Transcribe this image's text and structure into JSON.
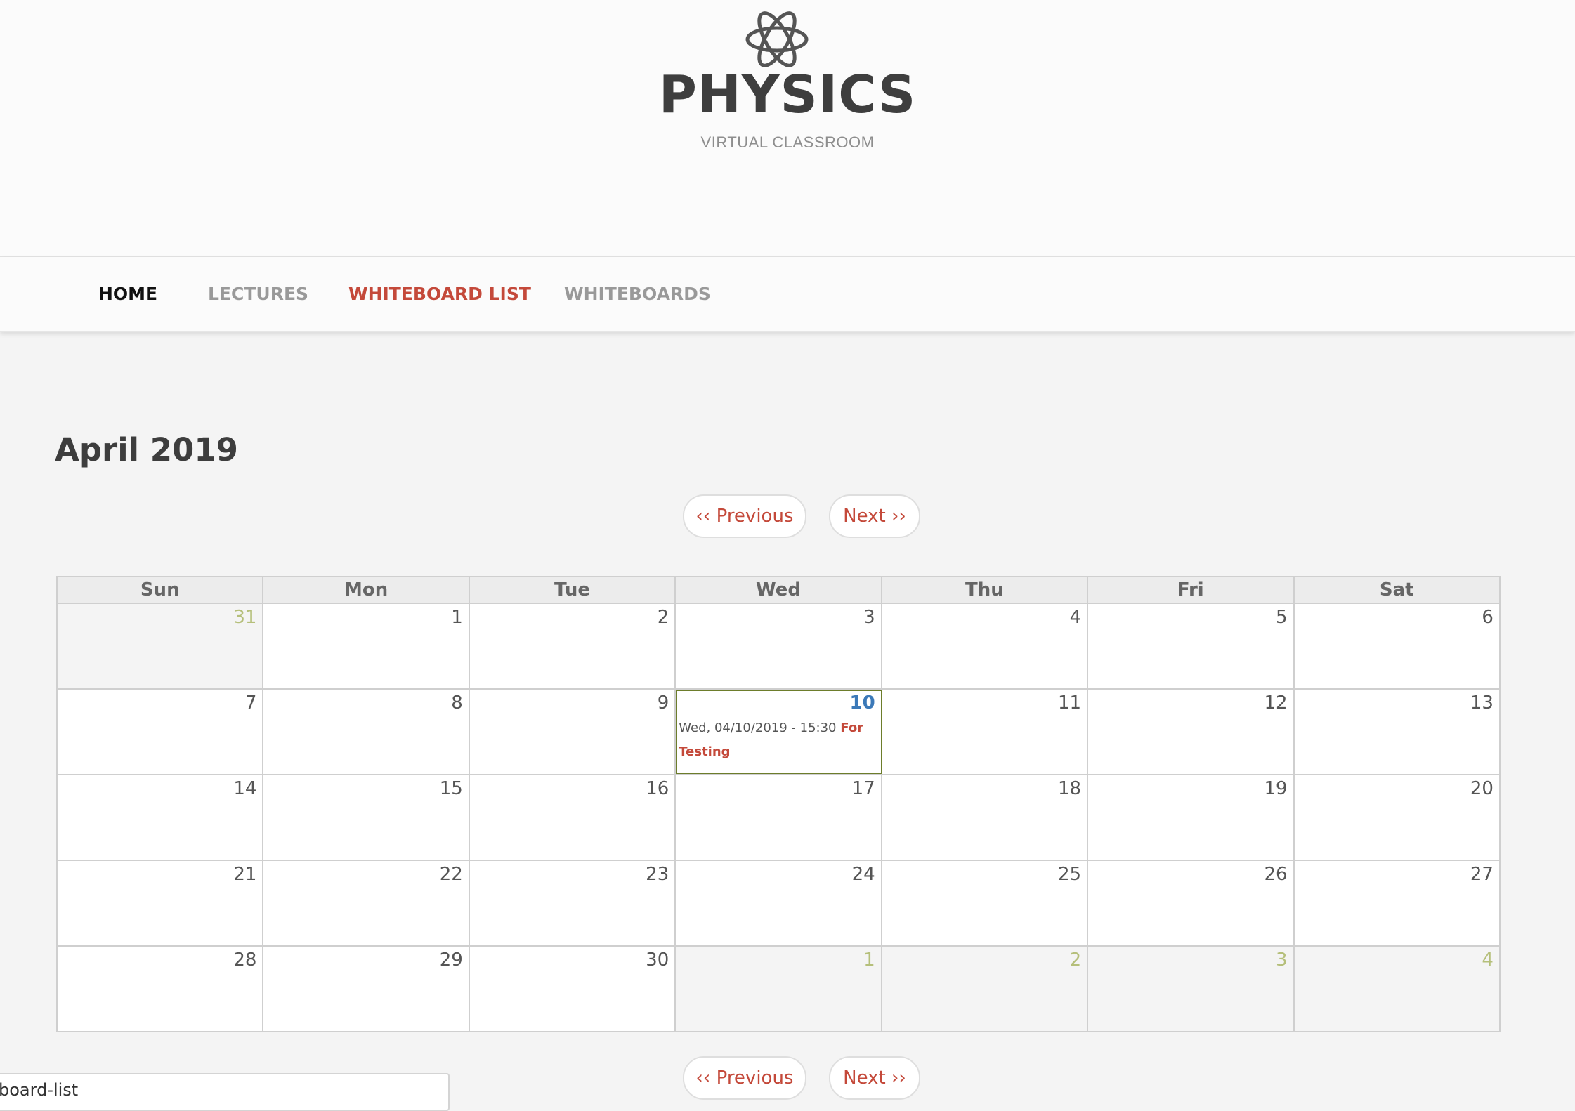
{
  "site": {
    "name": "PHYSICS",
    "slogan": "VIRTUAL CLASSROOM",
    "logo_icon": "atom-icon"
  },
  "nav": {
    "items": [
      {
        "label": "HOME"
      },
      {
        "label": "LECTURES"
      },
      {
        "label": "WHITEBOARD LIST"
      },
      {
        "label": "WHITEBOARDS"
      }
    ],
    "active": "WHITEBOARD LIST"
  },
  "calendar": {
    "title": "April 2019",
    "pager": {
      "previous": "‹‹ Previous",
      "next": "Next ››"
    },
    "weekdays": [
      "Sun",
      "Mon",
      "Tue",
      "Wed",
      "Thu",
      "Fri",
      "Sat"
    ],
    "weeks": [
      [
        "31",
        "1",
        "2",
        "3",
        "4",
        "5",
        "6"
      ],
      [
        "7",
        "8",
        "9",
        "10",
        "11",
        "12",
        "13"
      ],
      [
        "14",
        "15",
        "16",
        "17",
        "18",
        "19",
        "20"
      ],
      [
        "21",
        "22",
        "23",
        "24",
        "25",
        "26",
        "27"
      ],
      [
        "28",
        "29",
        "30",
        "1",
        "2",
        "3",
        "4"
      ]
    ],
    "today": "10",
    "event": {
      "date_text": "Wed, 04/10/2019 - 15:30",
      "title": "For Testing"
    }
  },
  "status_bar": {
    "url_fragment": "board-list"
  },
  "colors": {
    "accent": "#c4493a",
    "today_number": "#3b79b8",
    "other_month_number": "#b5bf7a",
    "today_border": "#6d7d2b"
  }
}
